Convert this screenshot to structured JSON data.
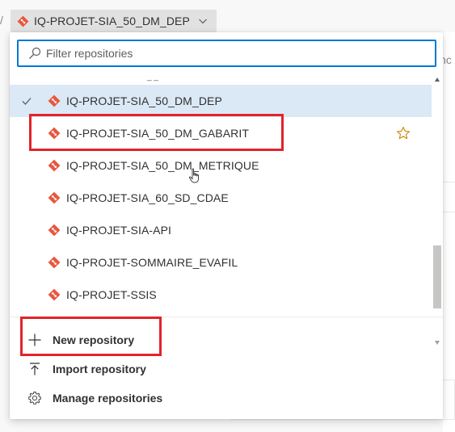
{
  "header": {
    "separator": "/",
    "selected_repo": "IQ-PROJET-SIA_50_DM_DEP"
  },
  "background": {
    "partial_text": "inc"
  },
  "dropdown": {
    "filter_placeholder": "Filter repositories",
    "partial_item": "_ _",
    "repositories": [
      {
        "name": "IQ-PROJET-SIA_50_DM_DEP",
        "selected": true
      },
      {
        "name": "IQ-PROJET-SIA_50_DM_GABARIT",
        "hovered": true,
        "favorite_icon": "star-outline-icon"
      },
      {
        "name": "IQ-PROJET-SIA_50_DM_METRIQUE"
      },
      {
        "name": "IQ-PROJET-SIA_60_SD_CDAE"
      },
      {
        "name": "IQ-PROJET-SIA-API"
      },
      {
        "name": "IQ-PROJET-SOMMAIRE_EVAFIL"
      },
      {
        "name": "IQ-PROJET-SSIS"
      }
    ],
    "actions": [
      {
        "label": "New repository",
        "icon": "plus-icon"
      },
      {
        "label": "Import repository",
        "icon": "import-icon"
      },
      {
        "label": "Manage repositories",
        "icon": "gear-icon"
      }
    ]
  },
  "colors": {
    "accent": "#0078d4",
    "git_icon": "#e8573d",
    "star": "#ca8a04",
    "selected_row": "#dbe8f5",
    "annotation_red": "#e0242a"
  }
}
